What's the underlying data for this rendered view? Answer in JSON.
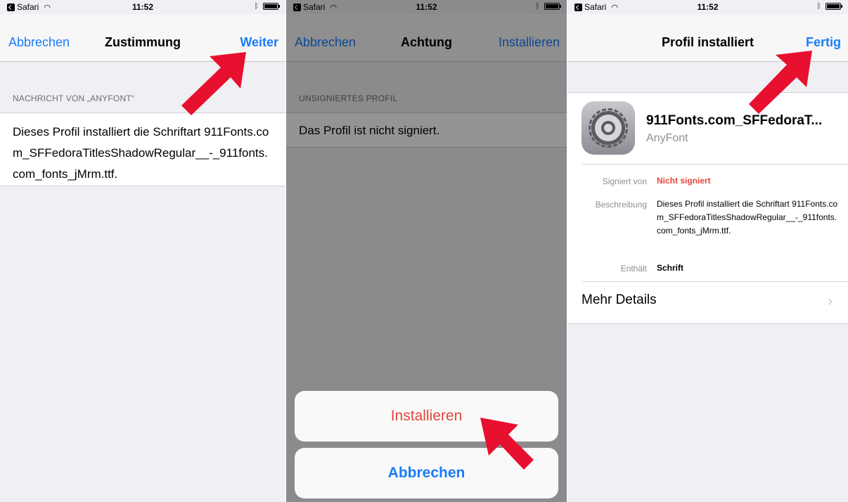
{
  "status": {
    "app": "Safari",
    "time": "11:52"
  },
  "screen1": {
    "nav_left": "Abbrechen",
    "title": "Zustimmung",
    "nav_right": "Weiter",
    "section_header": "NACHRICHT VON „ANYFONT“",
    "message": "Dieses Profil installiert die Schriftart 911Fonts.com_SFFedoraTitlesShadowRegular__-_911fonts.com_fonts_jMrm.ttf."
  },
  "screen2": {
    "nav_left": "Abbrechen",
    "title": "Achtung",
    "nav_right": "Installieren",
    "section_header": "UNSIGNIERTES PROFIL",
    "message": "Das Profil ist nicht signiert.",
    "action_install": "Installieren",
    "action_cancel": "Abbrechen"
  },
  "screen3": {
    "title": "Profil installiert",
    "nav_right": "Fertig",
    "profile_name": "911Fonts.com_SFFedoraT...",
    "profile_org": "AnyFont",
    "signed_label": "Signiert von",
    "signed_value": "Nicht signiert",
    "desc_label": "Beschreibung",
    "desc_value": "Dieses Profil installiert die Schriftart 911Fonts.com_SFFedoraTitlesShadowRegular__-_911fonts.com_fonts_jMrm.ttf.",
    "contains_label": "Enthält",
    "contains_value": "Schrift",
    "more_details": "Mehr Details"
  },
  "colors": {
    "accent": "#1a7cf7",
    "destructive": "#e8443a",
    "arrow": "#e8102f"
  }
}
